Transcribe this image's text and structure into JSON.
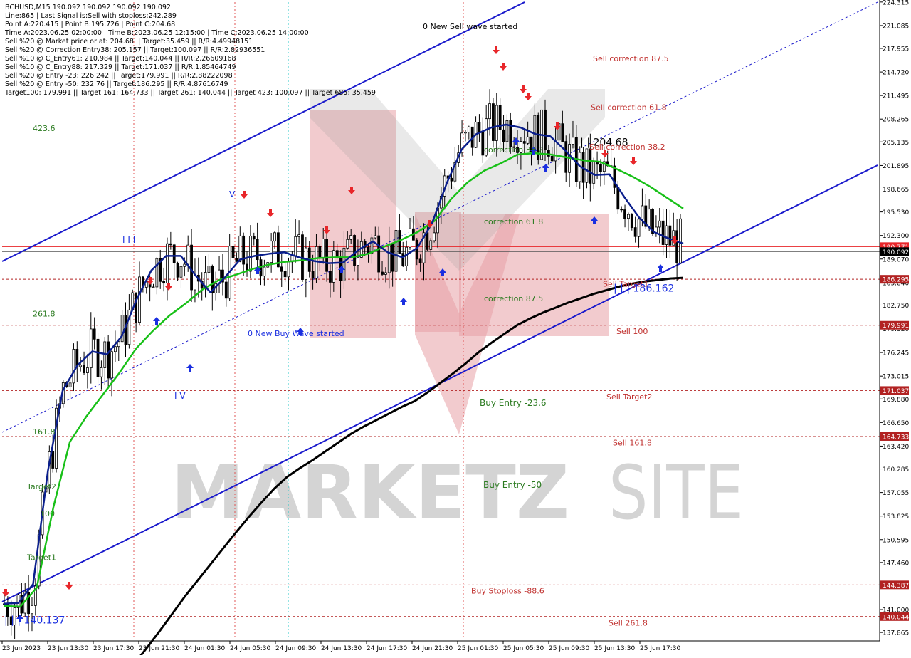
{
  "info_lines": [
    "BCHUSD,M15  190.092 190.092 190.092 190.092",
    "Line:865 | Last Signal is:Sell with stoploss:242.289",
    "Point A:220.415 | Point B:195.726 | Point C:204.68",
    "Time A:2023.06.25 02:00:00 | Time B:2023.06.25 12:15:00 | Time C:2023.06.25 14:00:00",
    "Sell %20 @ Market price or at: 204.68 || Target:35.459 || R/R:4.49948151",
    "Sell %20 @ Correction Entry38: 205.157 || Target:100.097 || R/R:2.82936551",
    "Sell %10 @ C_Entry61: 210.984 || Target:140.044 || R/R:2.26609168",
    "Sell %10 @ C_Entry88: 217.329 || Target:171.037 || R/R:1.85464749",
    "Sell %20 @ Entry -23: 226.242 || Target:179.991 || R/R:2.88222098",
    "Sell %20 @ Entry -50: 232.76 || Target:186.295 || R/R:4.87616749",
    "Target100: 179.991 || Target 161: 164.733 || Target 261: 140.044 || Target 423: 100.097 || Target 685: 35.459"
  ],
  "watermark": {
    "left": "MARKETZ",
    "right": "SITE"
  },
  "chart_data": {
    "type": "line",
    "symbol": "BCHUSD",
    "timeframe": "M15",
    "last_price": 190.092,
    "ylim": [
      136.9,
      224.3
    ],
    "y_ticks": [
      "224.315",
      "221.085",
      "217.955",
      "214.720",
      "211.495",
      "208.265",
      "205.135",
      "201.895",
      "198.665",
      "195.530",
      "192.300",
      "189.070",
      "185.840",
      "182.750",
      "179.520",
      "176.245",
      "173.015",
      "169.880",
      "166.650",
      "163.420",
      "160.285",
      "157.055",
      "153.825",
      "150.595",
      "147.460",
      "144.230",
      "141.000",
      "137.865"
    ],
    "x_ticks": [
      "23 Jun 2023",
      "23 Jun 13:30",
      "23 Jun 17:30",
      "23 Jun 21:30",
      "24 Jun 01:30",
      "24 Jun 05:30",
      "24 Jun 09:30",
      "24 Jun 13:30",
      "24 Jun 17:30",
      "24 Jun 21:30",
      "25 Jun 01:30",
      "25 Jun 05:30",
      "25 Jun 09:30",
      "25 Jun 13:30",
      "25 Jun 17:30"
    ],
    "price_tags": [
      {
        "label": "190.771",
        "value": 190.771,
        "color": "#e8262a"
      },
      {
        "label": "190.092",
        "value": 190.092,
        "color": "#000000"
      },
      {
        "label": "186.295",
        "value": 186.295,
        "color": "#b22222"
      },
      {
        "label": "179.991",
        "value": 179.991,
        "color": "#b22222"
      },
      {
        "label": "171.037",
        "value": 171.037,
        "color": "#b22222"
      },
      {
        "label": "164.733",
        "value": 164.733,
        "color": "#b22222"
      },
      {
        "label": "144.387",
        "value": 144.387,
        "color": "#b22222"
      },
      {
        "label": "140.044",
        "value": 140.044,
        "color": "#b22222"
      }
    ],
    "dashed_levels": [
      {
        "name": "Sell Target1",
        "value": 186.295
      },
      {
        "name": "Sell 100",
        "value": 179.991
      },
      {
        "name": "Sell Target2",
        "value": 171.037
      },
      {
        "name": "Sell 161.8",
        "value": 164.733
      },
      {
        "name": "Buy Stoploss -88.6",
        "value": 144.387
      },
      {
        "name": "Sell 261.8",
        "value": 140.044
      }
    ],
    "annotations_red": [
      {
        "text": "Sell correction 87.5",
        "value": 216.6
      },
      {
        "text": "Sell correction 61.8",
        "value": 209.9
      },
      {
        "text": "Sell correction 38.2",
        "value": 204.5
      },
      {
        "text": "Sell Target1",
        "value": 185.7
      },
      {
        "text": "Sell 100",
        "value": 179.2
      },
      {
        "text": "Sell Target2",
        "value": 170.2
      },
      {
        "text": "Sell 161.8",
        "value": 163.9
      },
      {
        "text": "Buy Stoploss -88.6",
        "value": 143.6
      },
      {
        "text": "Sell  261.8",
        "value": 139.2
      }
    ],
    "annotations_green": [
      {
        "text": "423.6",
        "value": 207.0
      },
      {
        "text": "261.8",
        "value": 181.6
      },
      {
        "text": "161.8",
        "value": 165.4
      },
      {
        "text": "Target2",
        "value": 157.9
      },
      {
        "text": "100",
        "value": 154.2
      },
      {
        "text": "Target1",
        "value": 148.2
      },
      {
        "text": "correction 38.2",
        "value": 204.1
      },
      {
        "text": "correction 61.8",
        "value": 194.2
      },
      {
        "text": "correction 87.5",
        "value": 183.7
      },
      {
        "text": "Buy Entry -23.6",
        "value": 169.3
      },
      {
        "text": "Buy Entry -50",
        "value": 158.1
      }
    ],
    "annotations_black": [
      {
        "text": "0 New Sell wave started",
        "value": 221.0
      },
      {
        "text": "| | | 204.68",
        "value": 205.0
      }
    ],
    "annotations_blue": [
      {
        "text": "0 New Buy Wave started",
        "value": 178.9
      },
      {
        "text": "| | | 186.162",
        "value": 185.0
      },
      {
        "text": "| | | 140.137",
        "value": 139.5
      }
    ],
    "wave_labels": [
      "V",
      "I I I",
      "I V"
    ],
    "series": [
      {
        "name": "",
        "color": "#000000",
        "values": [
          132.0,
          133.5,
          135.7,
          138.0,
          140.4,
          142.8,
          145.0,
          147.2,
          149.4,
          151.6,
          153.7,
          155.7,
          157.6,
          159.2,
          160.4,
          161.5,
          162.7,
          163.9,
          165.1,
          166.1,
          167.0,
          167.9,
          168.8,
          169.6,
          170.8,
          172.1,
          173.4,
          174.8,
          176.3,
          177.6,
          178.8,
          180.0,
          180.9,
          181.7,
          182.4,
          183.1,
          183.7,
          184.3,
          184.8,
          185.3,
          185.7,
          186.0,
          186.2,
          186.4,
          186.5
        ]
      },
      {
        "name": "",
        "color": "#18c018",
        "values": [
          141.5,
          141.4,
          144.0,
          155.0,
          164.0,
          167.5,
          170.5,
          173.5,
          176.8,
          179.2,
          181.3,
          183.0,
          184.9,
          186.2,
          186.9,
          187.7,
          188.3,
          188.7,
          188.9,
          189.2,
          189.3,
          189.3,
          189.8,
          190.8,
          191.7,
          192.8,
          194.3,
          197.3,
          199.6,
          201.2,
          202.2,
          203.4,
          203.6,
          203.4,
          203.0,
          202.6,
          202.4,
          201.4,
          200.3,
          199.0,
          197.5,
          196.0
        ]
      },
      {
        "name": "",
        "color": "#0a1e8c",
        "values": [
          141.8,
          141.9,
          144.5,
          160.0,
          171.0,
          174.5,
          176.4,
          176.0,
          178.5,
          183.5,
          187.5,
          189.5,
          189.5,
          186.8,
          184.5,
          186.6,
          189.0,
          189.5,
          189.8,
          190.0,
          189.3,
          188.8,
          188.5,
          188.6,
          190.3,
          191.5,
          190.0,
          189.3,
          190.6,
          194.0,
          199.5,
          204.1,
          206.2,
          207.1,
          207.5,
          207.1,
          206.2,
          205.9,
          204.0,
          201.8,
          200.6,
          200.7,
          197.6,
          194.8,
          192.8,
          191.9,
          191.2
        ]
      }
    ]
  }
}
